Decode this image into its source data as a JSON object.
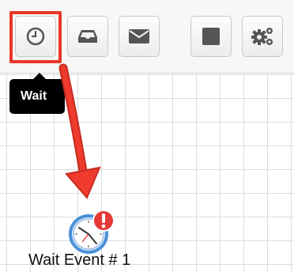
{
  "toolbar": {
    "buttons": [
      {
        "name": "wait",
        "icon": "clock-icon"
      },
      {
        "name": "receive",
        "icon": "inbox-icon"
      },
      {
        "name": "send-message",
        "icon": "envelope-icon"
      },
      {
        "name": "end",
        "icon": "stop-square-icon"
      },
      {
        "name": "settings",
        "icon": "gears-icon"
      }
    ],
    "selected": "wait"
  },
  "tooltip": {
    "text": "Wait"
  },
  "canvas": {
    "node": {
      "icon": "clock-icon",
      "badge_icon": "error-badge-icon",
      "label": "Wait Event # 1"
    }
  },
  "colors": {
    "highlight": "#e8372a",
    "error_badge": "#e53935",
    "clock_ring": "#4a90d9",
    "grid": "#dcdcdc",
    "icon_gray": "#555555"
  }
}
